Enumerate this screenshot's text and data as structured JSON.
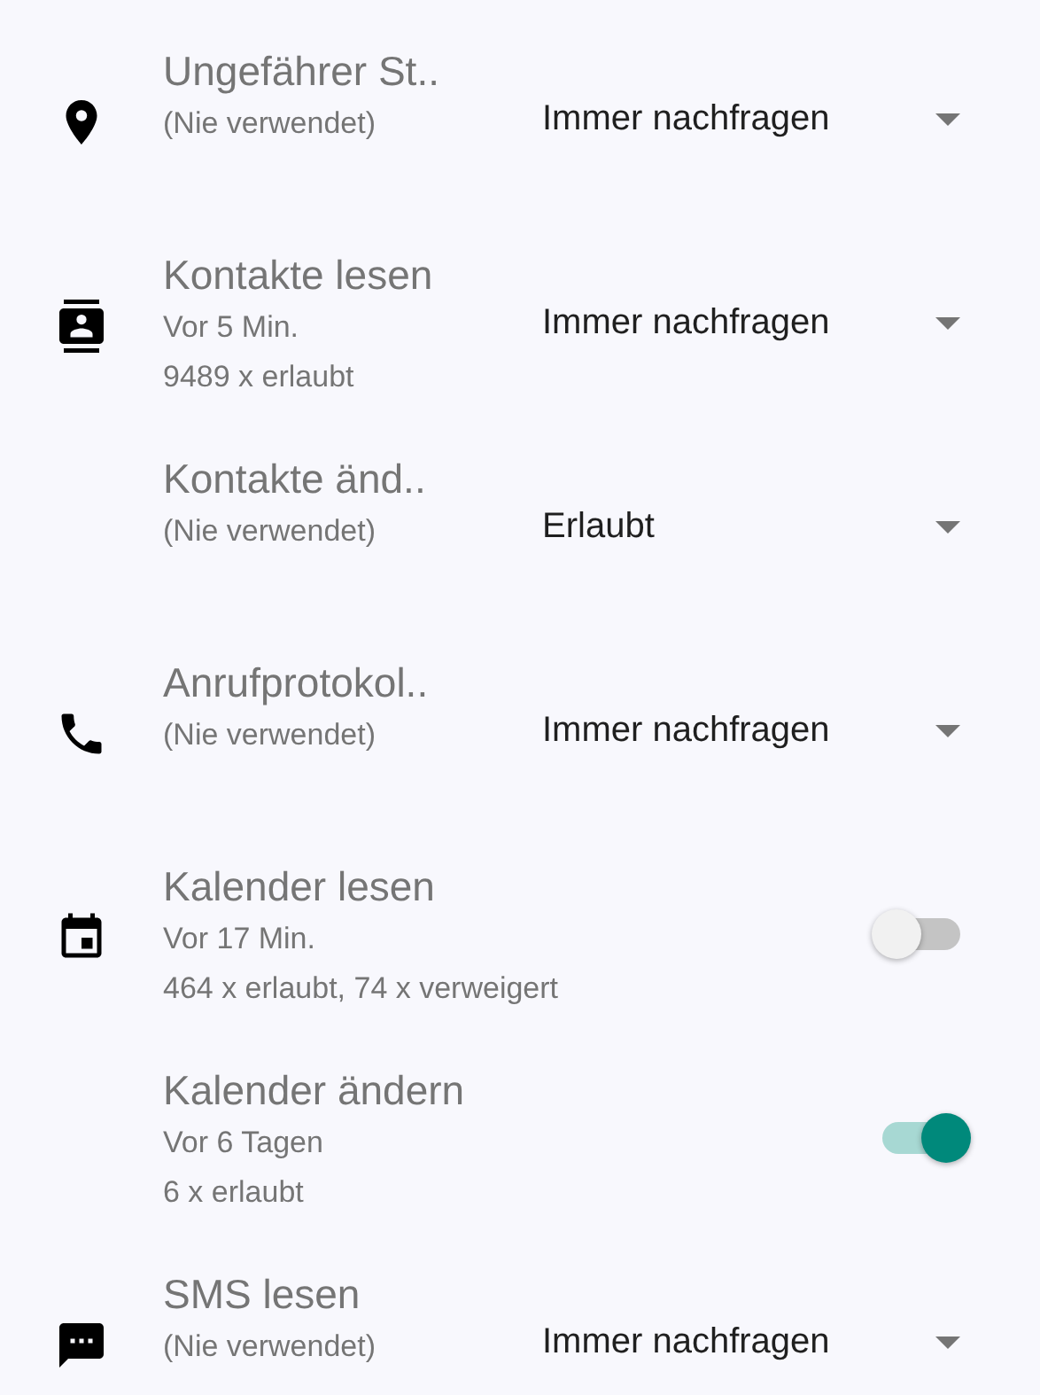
{
  "permissions": [
    {
      "title": "Ungefährer St..",
      "details": [
        "(Nie verwendet)"
      ],
      "control": {
        "kind": "dropdown",
        "value": "Immer nachfragen"
      }
    },
    {
      "title": "Kontakte lesen",
      "details": [
        "Vor 5 Min.",
        "9489 x erlaubt"
      ],
      "control": {
        "kind": "dropdown",
        "value": "Immer nachfragen"
      }
    },
    {
      "title": "Kontakte änd..",
      "details": [
        "(Nie verwendet)"
      ],
      "control": {
        "kind": "dropdown",
        "value": "Erlaubt"
      }
    },
    {
      "title": "Anrufprotokol..",
      "details": [
        "(Nie verwendet)"
      ],
      "control": {
        "kind": "dropdown",
        "value": "Immer nachfragen"
      }
    },
    {
      "title": "Kalender lesen",
      "details": [
        "Vor 17 Min.",
        "464 x erlaubt, 74 x verweigert"
      ],
      "control": {
        "kind": "switch",
        "on": false
      }
    },
    {
      "title": "Kalender ändern",
      "details": [
        "Vor 6 Tagen",
        "6 x erlaubt"
      ],
      "control": {
        "kind": "switch",
        "on": true
      }
    },
    {
      "title": "SMS lesen",
      "details": [
        "(Nie verwendet)"
      ],
      "control": {
        "kind": "dropdown",
        "value": "Immer nachfragen"
      }
    }
  ]
}
